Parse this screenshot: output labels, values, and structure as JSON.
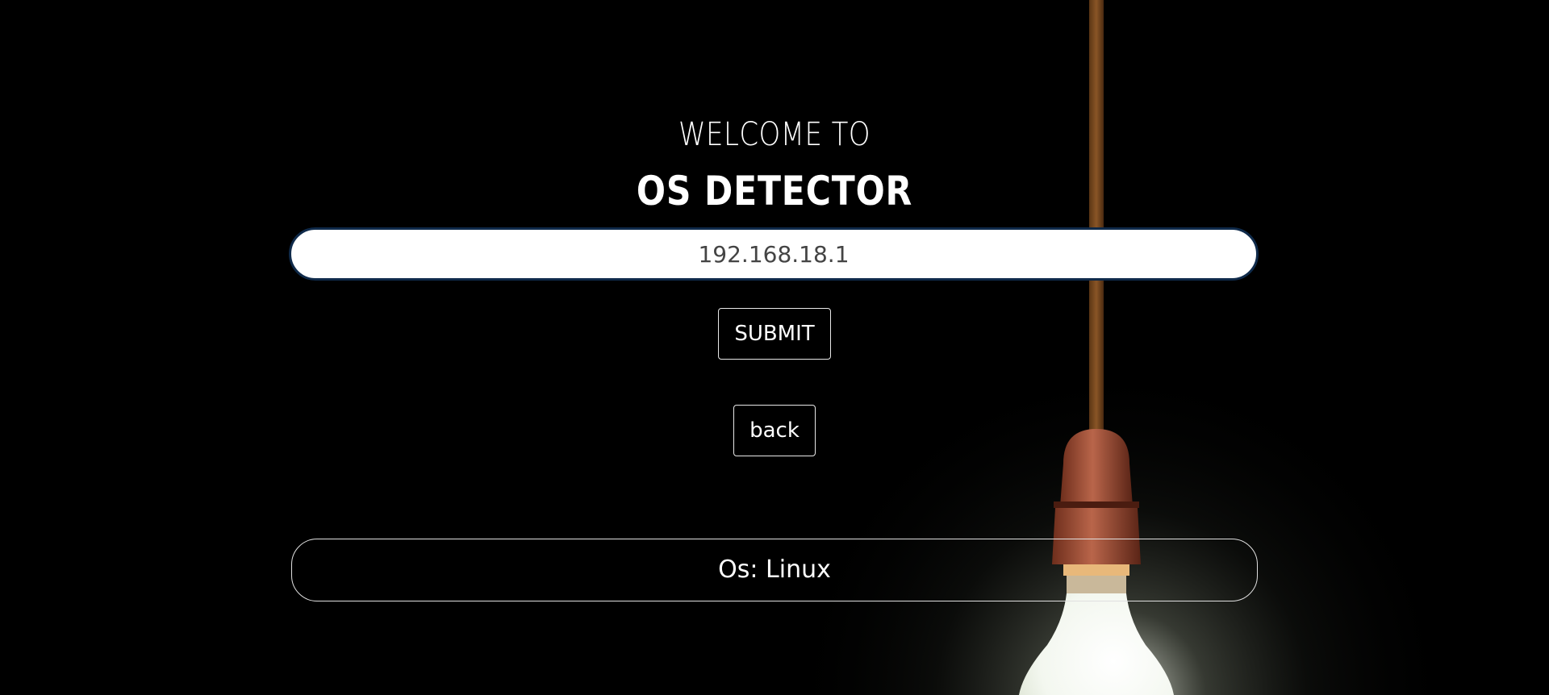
{
  "header": {
    "welcome": "WELCOME TO",
    "title": "OS DETECTOR"
  },
  "form": {
    "ip_value": "192.168.18.1",
    "submit_label": "SUBMIT",
    "back_label": "back"
  },
  "result": {
    "text": "Os: Linux"
  },
  "colors": {
    "background": "#000000",
    "text": "#ffffff",
    "input_border": "#0f2a4a",
    "cord": "#7a4a1e",
    "socket": "#a5543a"
  },
  "background_image": "hanging-light-bulb"
}
